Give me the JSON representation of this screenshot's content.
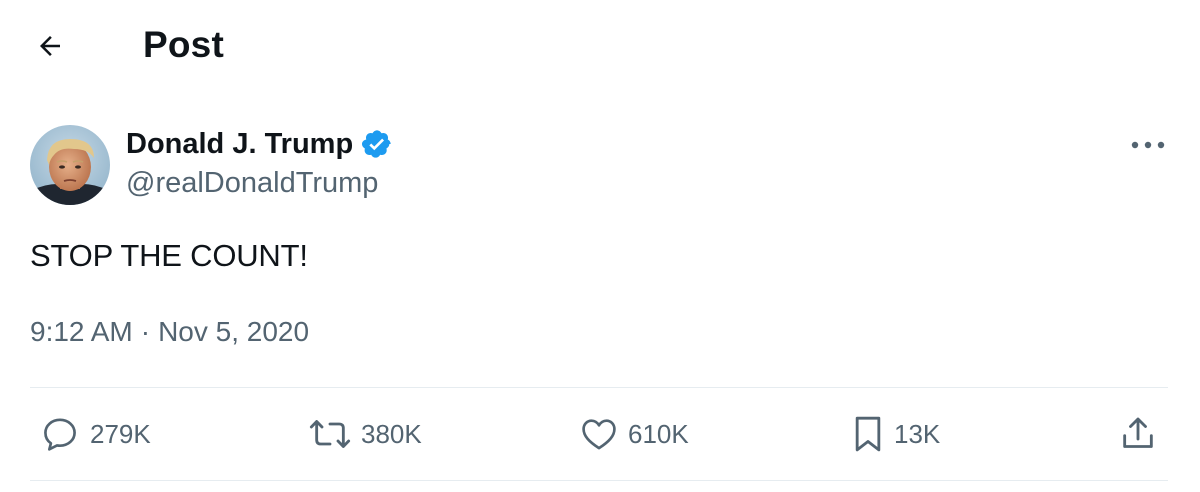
{
  "header": {
    "title": "Post",
    "back_icon": "arrow-left-icon"
  },
  "author": {
    "name": "Donald J. Trump",
    "handle": "@realDonaldTrump",
    "verified": true,
    "verified_color": "#1d9bf0"
  },
  "tweet": {
    "text": "STOP THE COUNT!",
    "time": "9:12 AM",
    "separator": "·",
    "date": "Nov 5, 2020"
  },
  "actions": {
    "reply": {
      "icon": "reply-icon",
      "count": "279K"
    },
    "retweet": {
      "icon": "retweet-icon",
      "count": "380K"
    },
    "like": {
      "icon": "heart-icon",
      "count": "610K"
    },
    "bookmark": {
      "icon": "bookmark-icon",
      "count": "13K"
    },
    "share": {
      "icon": "share-icon"
    }
  },
  "colors": {
    "text_primary": "#0f1419",
    "text_secondary": "#536471",
    "divider": "#e6ecf0",
    "accent": "#1d9bf0"
  }
}
